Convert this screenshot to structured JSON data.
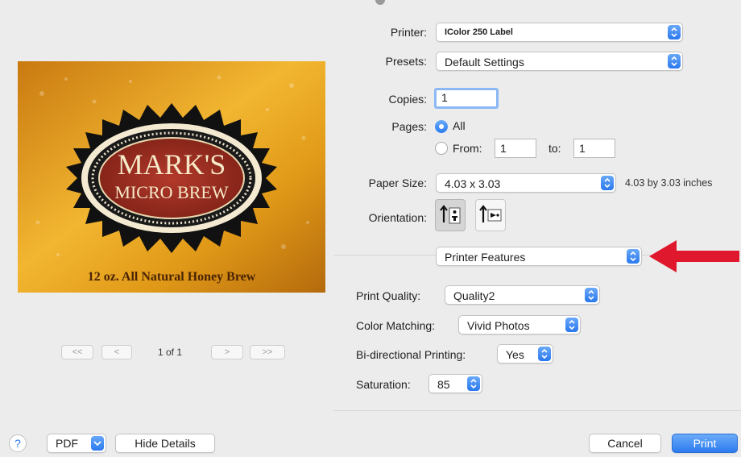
{
  "printer": {
    "label": "Printer:",
    "value": "IColor 250 Label"
  },
  "presets": {
    "label": "Presets:",
    "value": "Default Settings"
  },
  "copies": {
    "label": "Copies:",
    "value": "1"
  },
  "pages": {
    "label": "Pages:",
    "all_label": "All",
    "from_label": "From:",
    "from_value": "1",
    "to_label": "to:",
    "to_value": "1"
  },
  "paper_size": {
    "label": "Paper Size:",
    "value": "4.03 x 3.03",
    "description": "4.03 by 3.03 inches"
  },
  "orientation": {
    "label": "Orientation:"
  },
  "section_popup": {
    "value": "Printer Features"
  },
  "features": {
    "print_quality": {
      "label": "Print Quality:",
      "value": "Quality2"
    },
    "color_matching": {
      "label": "Color Matching:",
      "value": "Vivid Photos"
    },
    "bidirectional": {
      "label": "Bi-directional Printing:",
      "value": "Yes"
    },
    "saturation": {
      "label": "Saturation:",
      "value": "85"
    }
  },
  "preview": {
    "line1": "MARK'S",
    "line2": "MICRO BREW",
    "tagline": "12 oz. All Natural Honey Brew",
    "page_indicator": "1 of 1",
    "first_label": "<<",
    "prev_label": "<",
    "next_label": ">",
    "last_label": ">>"
  },
  "footer": {
    "help_label": "?",
    "pdf_label": "PDF",
    "hide_details_label": "Hide Details",
    "cancel_label": "Cancel",
    "print_label": "Print"
  },
  "colors": {
    "accent": "#2a78ef",
    "arrow": "#e0182d",
    "label_gold": "#e8a21c",
    "oval_red": "#9e2a20"
  }
}
